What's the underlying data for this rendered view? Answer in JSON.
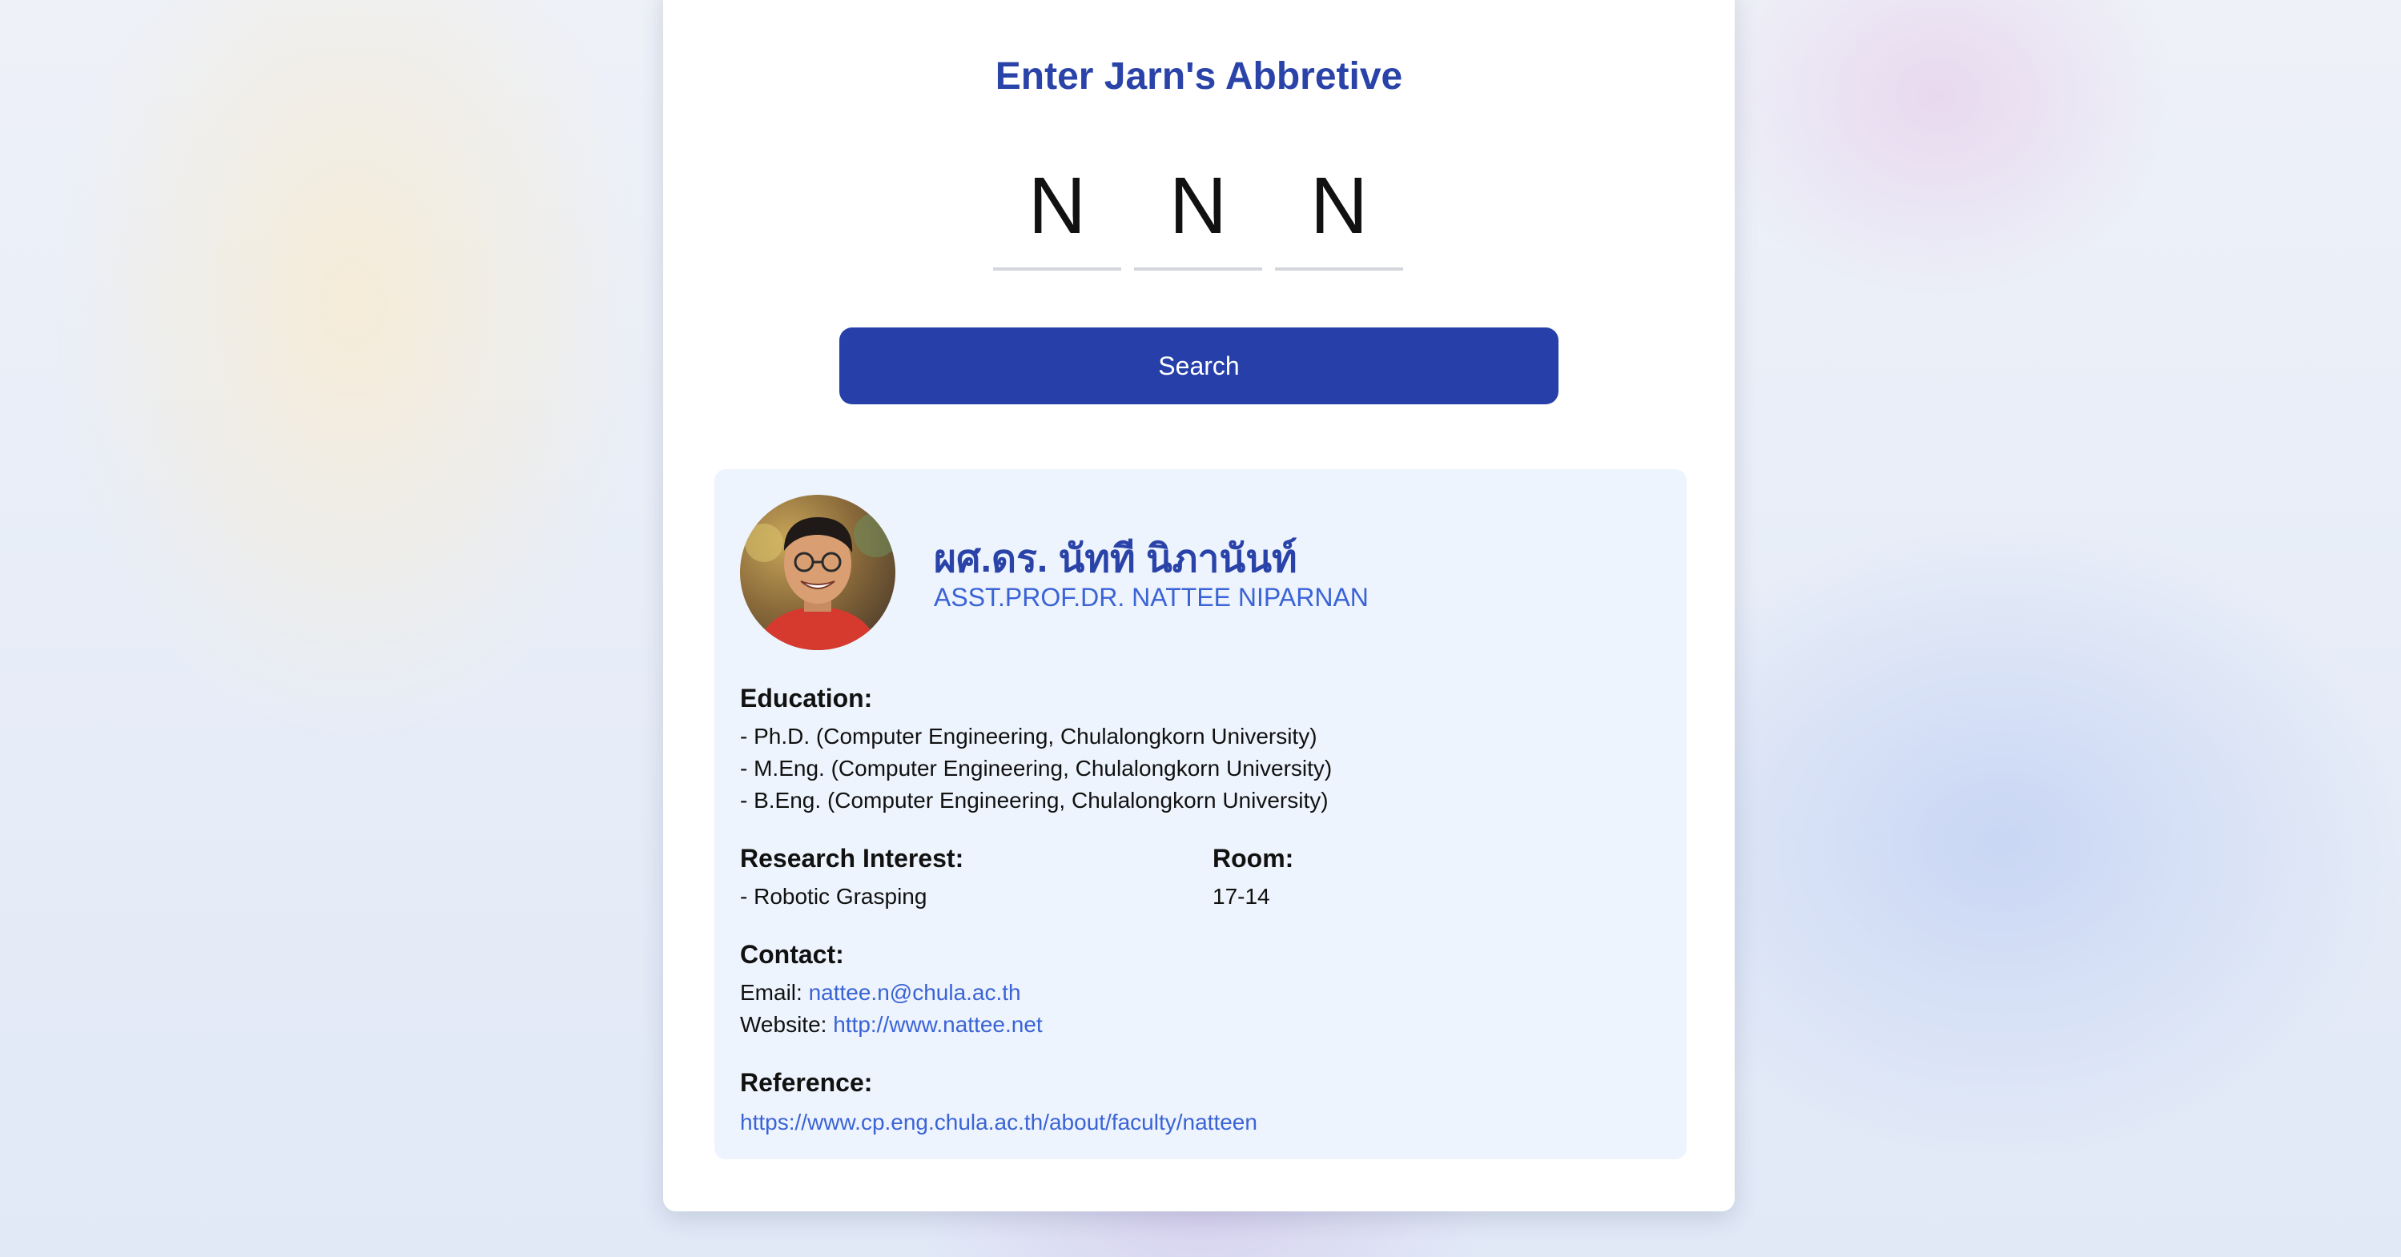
{
  "page": {
    "title": "Enter Jarn's Abbretive"
  },
  "abbreviation": {
    "letters": [
      "N",
      "N",
      "N"
    ]
  },
  "search": {
    "button_label": "Search"
  },
  "result": {
    "name_th": "ผศ.ดร. นัทที นิภานันท์",
    "name_en": "ASST.PROF.DR. NATTEE NIPARNAN",
    "education": {
      "heading": "Education:",
      "items": [
        "- Ph.D. (Computer Engineering, Chulalongkorn University)",
        "- M.Eng. (Computer Engineering, Chulalongkorn University)",
        "- B.Eng. (Computer Engineering, Chulalongkorn University)"
      ]
    },
    "research": {
      "heading": "Research Interest:",
      "items": [
        "- Robotic Grasping"
      ]
    },
    "room": {
      "heading": "Room:",
      "value": "17-14"
    },
    "contact": {
      "heading": "Contact:",
      "email_label": "Email:",
      "email": "nattee.n@chula.ac.th",
      "website_label": "Website:",
      "website": "http://www.nattee.net"
    },
    "reference": {
      "heading": "Reference:",
      "url": "https://www.cp.eng.chula.ac.th/about/faculty/natteen"
    }
  },
  "colors": {
    "accent": "#2740a9",
    "link": "#3a63d6",
    "result_bg": "#eef4fd"
  }
}
